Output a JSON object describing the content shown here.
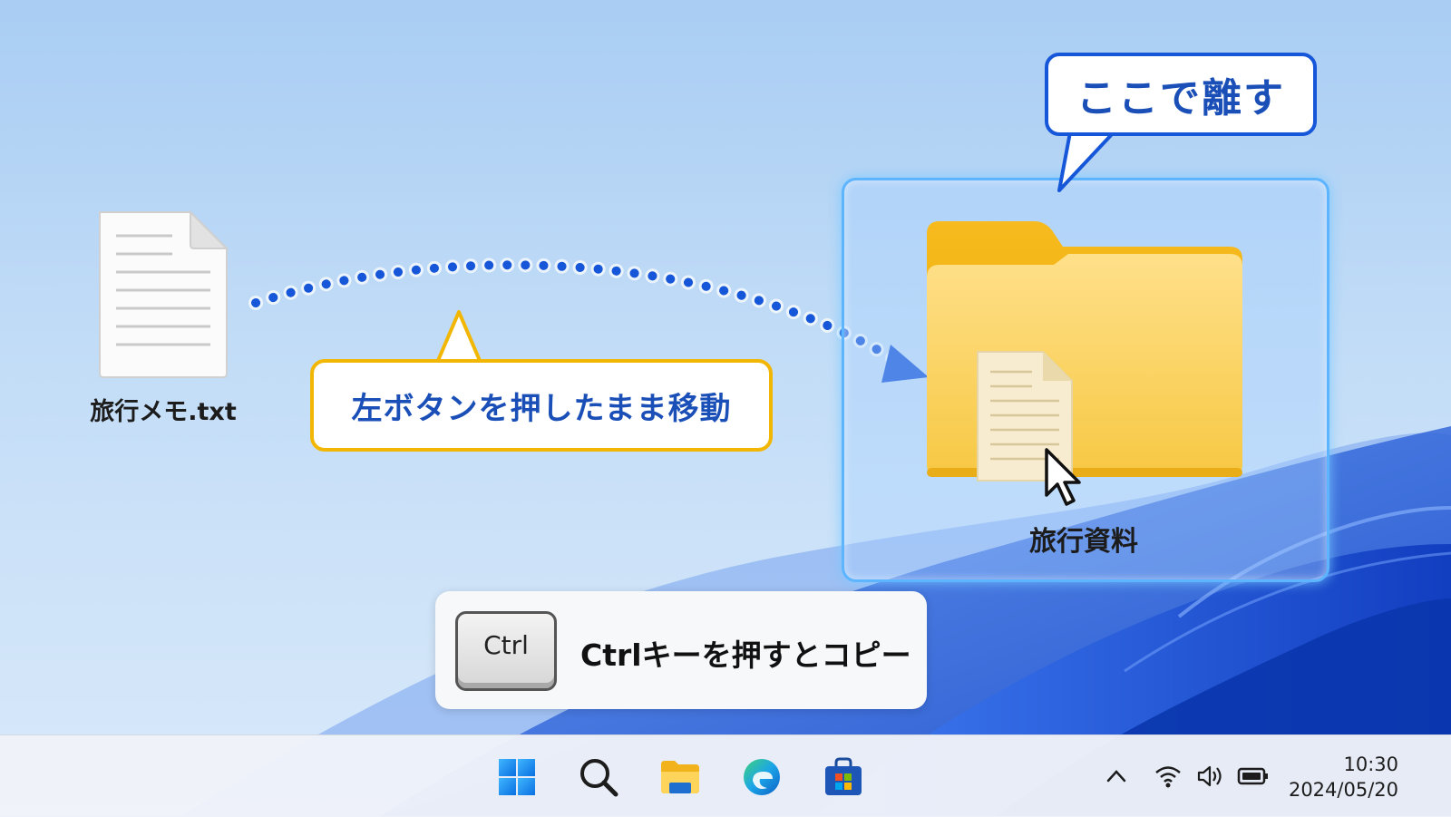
{
  "desktop": {
    "file": {
      "label": "旅行メモ.txt",
      "icon": "text-file-icon"
    },
    "folder": {
      "label": "旅行資料",
      "icon": "folder-icon"
    }
  },
  "callouts": {
    "drag_instruction": "左ボタンを押したまま移動",
    "release_here": "ここで離す"
  },
  "hint": {
    "key_label": "Ctrl",
    "text": "Ctrlキーを押すとコピー"
  },
  "taskbar": {
    "icons": [
      "windows-start-icon",
      "search-icon",
      "file-explorer-icon",
      "edge-browser-icon",
      "store-icon"
    ],
    "tray": [
      "chevron-up-icon",
      "wifi-icon",
      "speaker-icon",
      "battery-icon"
    ],
    "time": "10:30",
    "date": "2024/05/20"
  },
  "colors": {
    "accent_blue": "#1656d8",
    "accent_yellow": "#f2b705",
    "drop_highlight": "#5db4ff"
  }
}
